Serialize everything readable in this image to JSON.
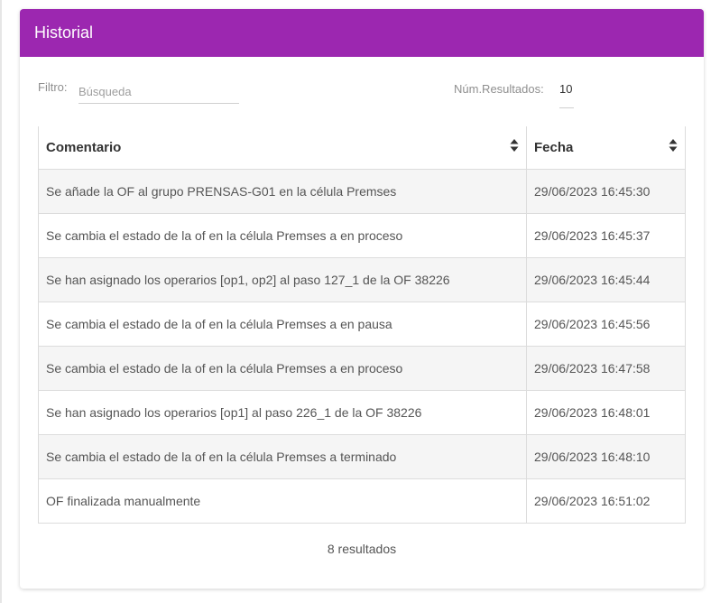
{
  "panel": {
    "title": "Historial",
    "header_color": "#9c27b0"
  },
  "filter": {
    "label": "Filtro:",
    "placeholder": "Búsqueda",
    "value": ""
  },
  "results": {
    "label": "Núm.Resultados:",
    "value": "10"
  },
  "table": {
    "columns": [
      {
        "label": "Comentario",
        "sort_icon": "sort-icon"
      },
      {
        "label": "Fecha",
        "sort_icon": "sort-icon"
      }
    ],
    "rows": [
      {
        "comentario": "Se añade la OF al grupo PRENSAS-G01 en la célula Premses",
        "fecha": "29/06/2023 16:45:30"
      },
      {
        "comentario": "Se cambia el estado de la of en la célula Premses a en proceso",
        "fecha": "29/06/2023 16:45:37"
      },
      {
        "comentario": "Se han asignado los operarios [op1, op2] al paso 127_1 de la OF 38226",
        "fecha": "29/06/2023 16:45:44"
      },
      {
        "comentario": "Se cambia el estado de la of en la célula Premses a en pausa",
        "fecha": "29/06/2023 16:45:56"
      },
      {
        "comentario": "Se cambia el estado de la of en la célula Premses a en proceso",
        "fecha": "29/06/2023 16:47:58"
      },
      {
        "comentario": "Se han asignado los operarios [op1] al paso 226_1 de la OF 38226",
        "fecha": "29/06/2023 16:48:01"
      },
      {
        "comentario": "Se cambia el estado de la of en la célula Premses a terminado",
        "fecha": "29/06/2023 16:48:10"
      },
      {
        "comentario": "OF finalizada manualmente",
        "fecha": "29/06/2023 16:51:02"
      }
    ]
  },
  "footer": {
    "count_text": "8 resultados"
  }
}
